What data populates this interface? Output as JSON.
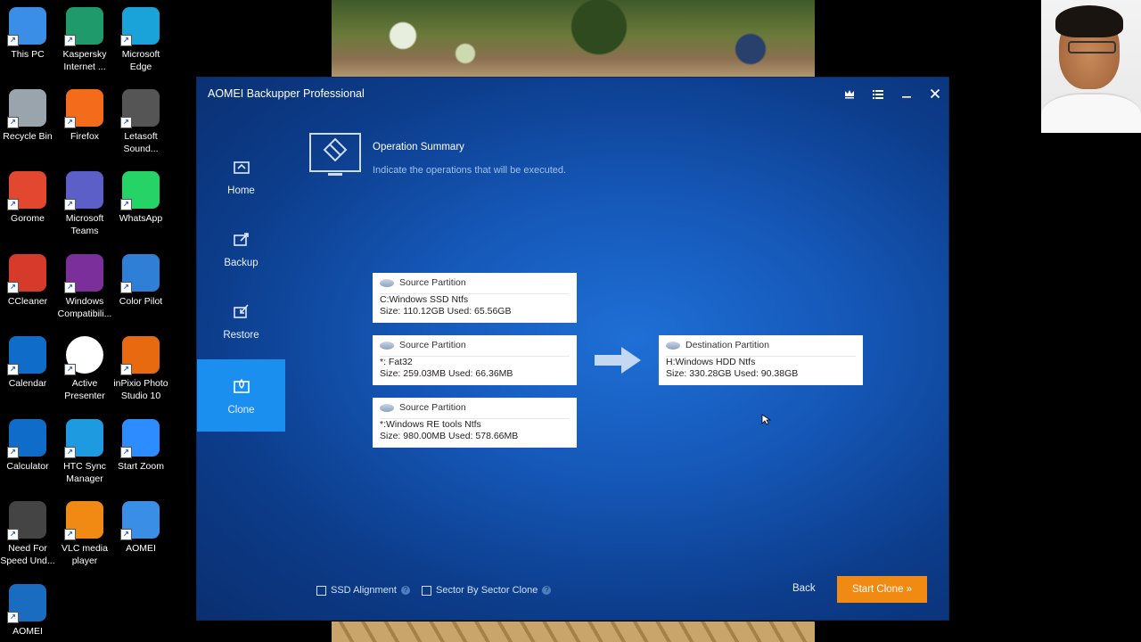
{
  "desktop": {
    "icons": [
      {
        "label": "This PC",
        "icon": "this-pc-icon",
        "color": "#3a8ee6"
      },
      {
        "label": "Kaspersky Internet ...",
        "icon": "kaspersky-icon",
        "color": "#1f9a6a"
      },
      {
        "label": "Microsoft Edge",
        "icon": "edge-icon",
        "color": "#1aa3d9"
      },
      {
        "label": "Recycle Bin",
        "icon": "recycle-bin-icon",
        "color": "#9aa4ad"
      },
      {
        "label": "Firefox",
        "icon": "firefox-icon",
        "color": "#f46b1c"
      },
      {
        "label": "Letasoft Sound...",
        "icon": "letasoft-sound-icon",
        "color": "#555555"
      },
      {
        "label": "Gorome",
        "icon": "chrome-icon",
        "color": "#e2472f"
      },
      {
        "label": "Microsoft Teams",
        "icon": "teams-icon",
        "color": "#5b5fc7"
      },
      {
        "label": "WhatsApp",
        "icon": "whatsapp-icon",
        "color": "#25d366"
      },
      {
        "label": "CCleaner",
        "icon": "ccleaner-icon",
        "color": "#d63a2a"
      },
      {
        "label": "Windows Compatibili...",
        "icon": "windows-compat-icon",
        "color": "#7a2f9a"
      },
      {
        "label": "Color Pilot",
        "icon": "color-pilot-icon",
        "color": "#2f7fd6"
      },
      {
        "label": "Calendar",
        "icon": "calendar-icon",
        "color": "#0f6cc9"
      },
      {
        "label": "Active Presenter",
        "icon": "active-presenter-icon",
        "color": "#ffffff"
      },
      {
        "label": "inPixio Photo Studio 10",
        "icon": "inpixio-icon",
        "color": "#e86a10"
      },
      {
        "label": "Calculator",
        "icon": "calculator-icon",
        "color": "#0f6cc9"
      },
      {
        "label": "HTC Sync Manager",
        "icon": "htc-sync-icon",
        "color": "#1e9be0"
      },
      {
        "label": "Start Zoom",
        "icon": "zoom-icon",
        "color": "#2d8cff"
      },
      {
        "label": "Need For Speed Und...",
        "icon": "nfs-icon",
        "color": "#444444"
      },
      {
        "label": "VLC media player",
        "icon": "vlc-icon",
        "color": "#f08a12"
      },
      {
        "label": "AOMEI",
        "icon": "aomei-icon-1",
        "color": "#3a8ee6"
      },
      {
        "label": "AOMEI",
        "icon": "aomei-icon-2",
        "color": "#1a6cc0"
      }
    ]
  },
  "window": {
    "title": "AOMEI Backupper Professional"
  },
  "nav": {
    "items": [
      {
        "label": "Home",
        "icon": "home-icon"
      },
      {
        "label": "Backup",
        "icon": "backup-icon"
      },
      {
        "label": "Restore",
        "icon": "restore-icon"
      },
      {
        "label": "Clone",
        "icon": "clone-icon"
      }
    ],
    "active": "Clone"
  },
  "summary": {
    "title": "Operation Summary",
    "subtitle": "Indicate the operations that will be executed."
  },
  "sources": [
    {
      "header": "Source Partition",
      "line1": "C:Windows SSD Ntfs",
      "line2": "Size: 110.12GB  Used: 65.56GB"
    },
    {
      "header": "Source Partition",
      "line1": "*: Fat32",
      "line2": "Size: 259.03MB  Used: 66.36MB"
    },
    {
      "header": "Source Partition",
      "line1": "*:Windows RE tools Ntfs",
      "line2": "Size: 980.00MB  Used: 578.66MB"
    }
  ],
  "destination": {
    "header": "Destination Partition",
    "line1": "H:Windows HDD Ntfs",
    "line2": "Size: 330.28GB  Used: 90.38GB"
  },
  "options": {
    "ssd_alignment": "SSD Alignment",
    "sector_clone": "Sector By Sector Clone"
  },
  "buttons": {
    "back": "Back",
    "start_clone": "Start Clone »"
  },
  "colors": {
    "accent": "#1a8ff0",
    "start_button": "#f08a12",
    "window_bg": "#1558b8"
  }
}
